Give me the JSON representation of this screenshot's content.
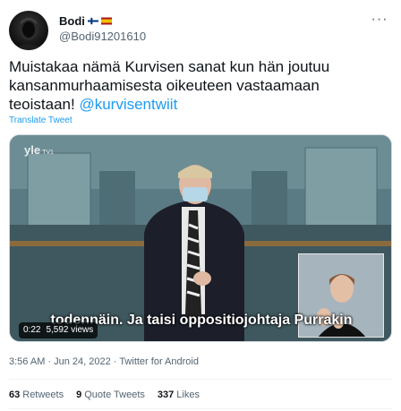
{
  "author": {
    "display_name": "Bodi",
    "handle": "@Bodi91201610",
    "flags": [
      "finland-flag",
      "spain-flag"
    ]
  },
  "tweet": {
    "text_before_mention": "Muistakaa nämä Kurvisen sanat kun hän joutuu kansanmurhaamisesta oikeuteen vastaamaan teoistaan! ",
    "mention": "@kurvisentwiit",
    "translate_label": "Translate Tweet"
  },
  "video": {
    "channel_logo": "yle",
    "channel_suffix": "TV1",
    "subtitle": "todennäin. Ja taisi oppositiojohtaja Purrakin",
    "time": "0:22",
    "views": "5,592 views"
  },
  "meta": {
    "timestamp": "3:56 AM · Jun 24, 2022 · Twitter for Android"
  },
  "stats": {
    "retweets_count": "63",
    "retweets_label": "Retweets",
    "quotes_count": "9",
    "quotes_label": "Quote Tweets",
    "likes_count": "337",
    "likes_label": "Likes"
  },
  "colors": {
    "accent": "#1d9bf0",
    "secondary_text": "#536471"
  }
}
